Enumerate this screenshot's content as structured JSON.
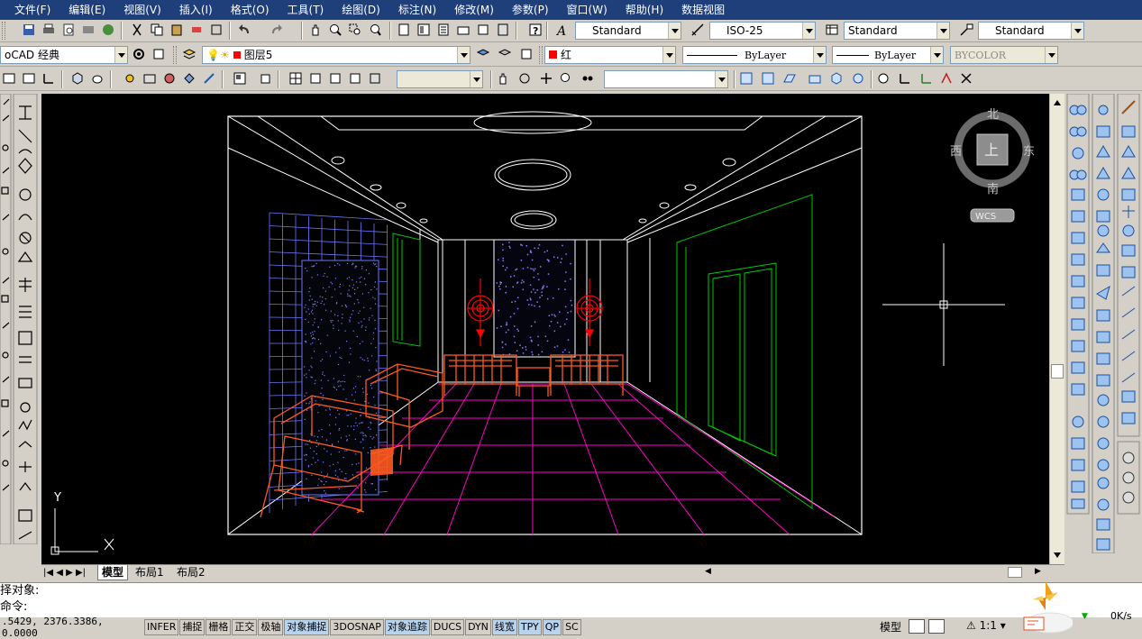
{
  "menu": {
    "items": [
      "文件(F)",
      "编辑(E)",
      "视图(V)",
      "插入(I)",
      "格式(O)",
      "工具(T)",
      "绘图(D)",
      "标注(N)",
      "修改(M)",
      "参数(P)",
      "窗口(W)",
      "帮助(H)",
      "数据视图"
    ]
  },
  "toolbar1": {
    "text_style": "Standard",
    "dim_style": "ISO-25",
    "table_style": "Standard",
    "mleader_style": "Standard"
  },
  "toolbar2": {
    "workspace": "oCAD 经典",
    "layer": "图层5",
    "color": "红",
    "linetype": "ByLayer",
    "lineweight": "ByLayer",
    "plotstyle": "BYCOLOR"
  },
  "viewcube": {
    "north": "北",
    "south": "南",
    "east": "东",
    "west": "西",
    "top": "上",
    "wcs": "WCS"
  },
  "ucs": {
    "x": "X",
    "y": "Y"
  },
  "tabs": {
    "model": "模型",
    "layout1": "布局1",
    "layout2": "布局2"
  },
  "command": {
    "line1": "择对象:",
    "line2": "命令:"
  },
  "status": {
    "coords": ".5429, 2376.3386, 0.0000",
    "buttons": [
      "INFER",
      "捕捉",
      "栅格",
      "正交",
      "极轴",
      "对象捕捉",
      "3DOSNAP",
      "对象追踪",
      "DUCS",
      "DYN",
      "线宽",
      "TPY",
      "QP",
      "SC"
    ],
    "on_buttons": [
      "对象捕捉",
      "对象追踪",
      "线宽",
      "TPY",
      "QP"
    ],
    "space": "模型",
    "scale": "1:1",
    "net_speed": "0K/s"
  },
  "colors": {
    "canvas": "#000000",
    "menubar": "#1f3f7a",
    "red": "#ff0000",
    "orange": "#ff5a1e",
    "magenta": "#ff00c8",
    "green": "#00c800",
    "blue": "#6a78ff"
  }
}
